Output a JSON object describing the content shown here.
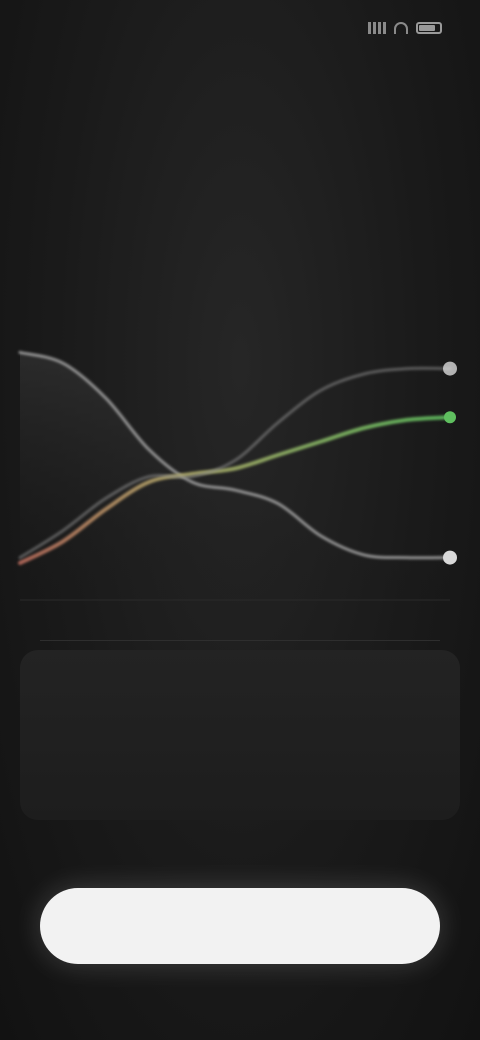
{
  "status_bar": {
    "time": "",
    "icons": [
      "cellular-signal-icon",
      "wifi-icon",
      "battery-icon"
    ]
  },
  "step_label": "",
  "headline": "",
  "chart_data": {
    "type": "line",
    "x": [
      0,
      1,
      2,
      3,
      4,
      5,
      6,
      7,
      8,
      9,
      10
    ],
    "series": [
      {
        "values": [
          88,
          84,
          71,
          52,
          40,
          37,
          32,
          20,
          13,
          12,
          12
        ],
        "color": "#9c9c9c"
      },
      {
        "values": [
          10,
          18,
          30,
          40,
          43,
          45,
          50,
          55,
          60,
          63,
          64
        ],
        "color": "#5fbf5f",
        "start_color": "#b86b5c"
      },
      {
        "values": [
          12,
          22,
          34,
          42,
          42,
          48,
          62,
          74,
          80,
          82,
          82
        ],
        "color": "#8e8e8e"
      }
    ],
    "ylim": [
      0,
      100
    ],
    "grid": false,
    "legend": "none"
  },
  "info_card": {
    "text": "",
    "note": ""
  },
  "cta": {
    "label": ""
  },
  "colors": {
    "background": "#151515",
    "accent_green": "#5fbf5f",
    "button": "#f2f2f2"
  }
}
